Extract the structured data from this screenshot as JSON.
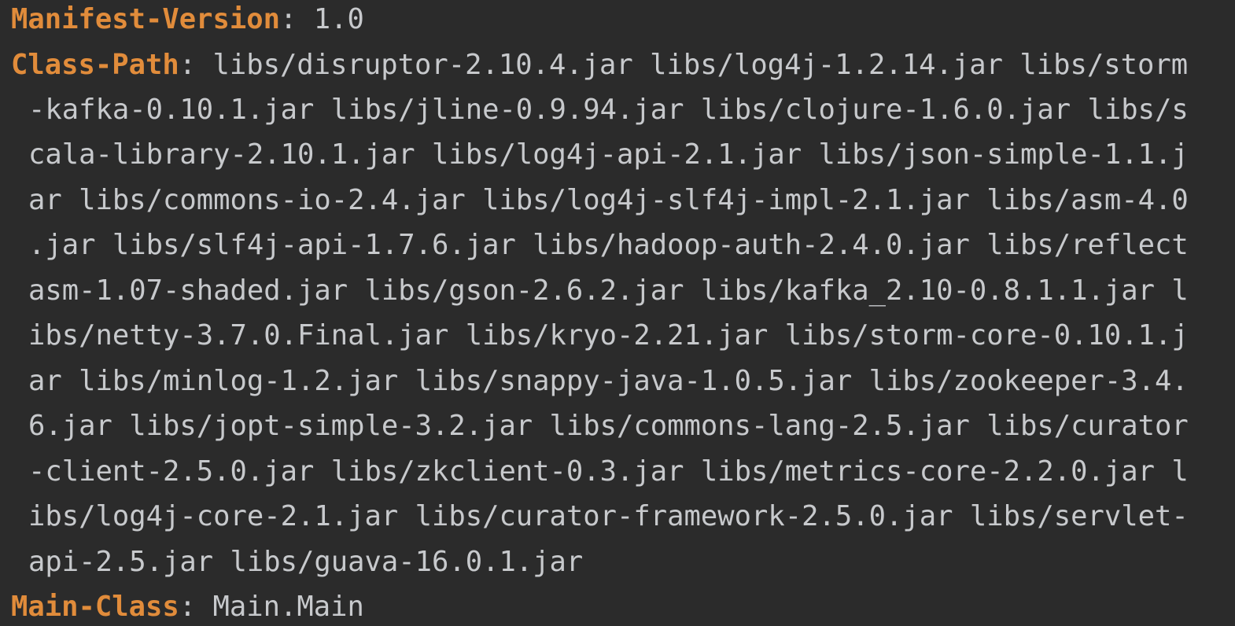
{
  "editor": {
    "manifest_version": {
      "key": "Manifest-Version",
      "sep": ": ",
      "value": "1.0"
    },
    "class_path": {
      "key": "Class-Path",
      "sep": ": ",
      "lines": [
        "libs/disruptor-2.10.4.jar libs/log4j-1.2.14.jar libs/storm",
        "-kafka-0.10.1.jar libs/jline-0.9.94.jar libs/clojure-1.6.0.jar libs/s",
        "cala-library-2.10.1.jar libs/log4j-api-2.1.jar libs/json-simple-1.1.j",
        "ar libs/commons-io-2.4.jar libs/log4j-slf4j-impl-2.1.jar libs/asm-4.0",
        ".jar libs/slf4j-api-1.7.6.jar libs/hadoop-auth-2.4.0.jar libs/reflect",
        "asm-1.07-shaded.jar libs/gson-2.6.2.jar libs/kafka_2.10-0.8.1.1.jar l",
        "ibs/netty-3.7.0.Final.jar libs/kryo-2.21.jar libs/storm-core-0.10.1.j",
        "ar libs/minlog-1.2.jar libs/snappy-java-1.0.5.jar libs/zookeeper-3.4.",
        "6.jar libs/jopt-simple-3.2.jar libs/commons-lang-2.5.jar libs/curator",
        "-client-2.5.0.jar libs/zkclient-0.3.jar libs/metrics-core-2.2.0.jar l",
        "ibs/log4j-core-2.1.jar libs/curator-framework-2.5.0.jar libs/servlet-",
        "api-2.5.jar libs/guava-16.0.1.jar"
      ]
    },
    "main_class": {
      "key": "Main-Class",
      "sep": ": ",
      "value": "Main.Main"
    }
  }
}
